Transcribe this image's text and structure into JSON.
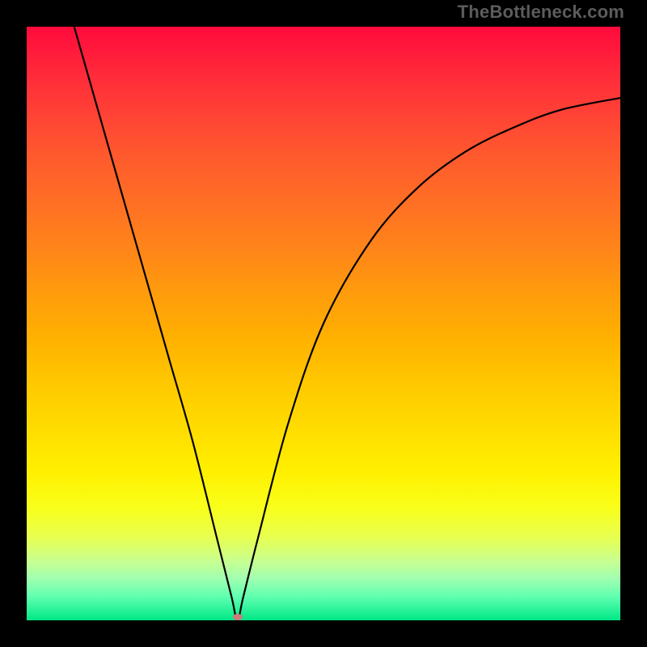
{
  "watermark": "TheBottleneck.com",
  "marker": {
    "x_pct": 35.5,
    "y_bottom_pct": 0.5
  },
  "chart_data": {
    "type": "line",
    "title": "",
    "xlabel": "",
    "ylabel": "",
    "xlim": [
      0,
      100
    ],
    "ylim": [
      0,
      100
    ],
    "grid": false,
    "legend": false,
    "series": [
      {
        "name": "bottleneck-curve",
        "x": [
          8,
          12,
          16,
          20,
          24,
          28,
          32,
          34.5,
          35.5,
          36.5,
          39,
          44,
          50,
          58,
          66,
          74,
          82,
          90,
          100
        ],
        "y": [
          100,
          86,
          72,
          58,
          44,
          30,
          14,
          4,
          0,
          4,
          14,
          33,
          50,
          64,
          73,
          79,
          83,
          86,
          88
        ]
      }
    ],
    "annotations": [
      {
        "type": "marker",
        "x": 35.5,
        "y": 0,
        "color": "#cc7a7a"
      }
    ],
    "background_gradient": {
      "direction": "vertical",
      "stops": [
        {
          "pos": 0,
          "color": "#ff0a3c"
        },
        {
          "pos": 50,
          "color": "#ffb200"
        },
        {
          "pos": 80,
          "color": "#fff000"
        },
        {
          "pos": 100,
          "color": "#00e886"
        }
      ]
    },
    "watermark_text": "TheBottleneck.com"
  }
}
